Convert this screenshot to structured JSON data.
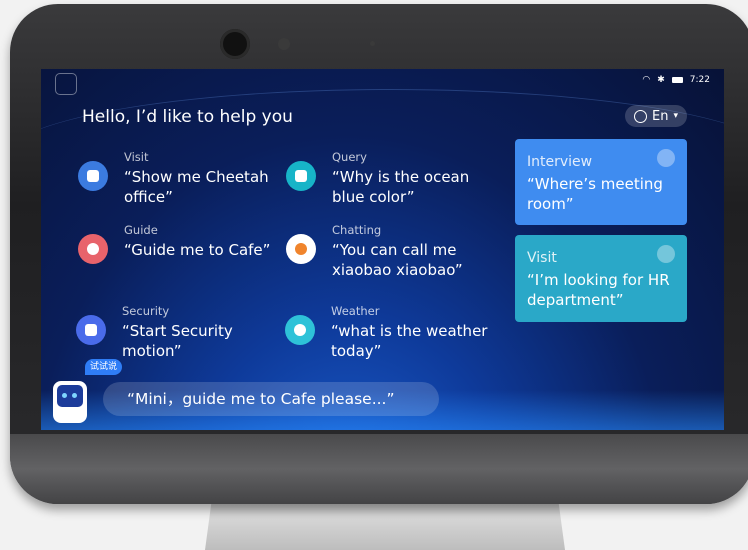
{
  "status": {
    "time": "7:22"
  },
  "greeting": "Hello, I’d like to help you",
  "language": {
    "label": "En",
    "caret": "▾"
  },
  "items": [
    {
      "category": "Visit",
      "text": "“Show me Cheetah office”",
      "color": "#3b7be0"
    },
    {
      "category": "Query",
      "text": "“Why is the ocean blue color”",
      "color": "#17b4c8"
    },
    {
      "category": "Guide",
      "text": "“Guide me to Cafe”",
      "color": "#e8636b"
    },
    {
      "category": "Chatting",
      "text": "“You can call me xiaobao xiaobao”",
      "color": "#f0842c"
    },
    {
      "category": "Security",
      "text": "“Start Security motion”",
      "color": "#4a6bea"
    },
    {
      "category": "Weather",
      "text": "“what is the weather today”",
      "color": "#2ec2d8"
    }
  ],
  "cards": [
    {
      "title": "Interview",
      "text": "“Where’s meeting room”",
      "color": "#3f8cf0"
    },
    {
      "title": "Visit",
      "text": "“I’m looking for HR department”",
      "color": "#2aa8c8"
    }
  ],
  "assistant": {
    "badge": "试试说",
    "prompt": "“Mini，guide me to Cafe please...”"
  }
}
